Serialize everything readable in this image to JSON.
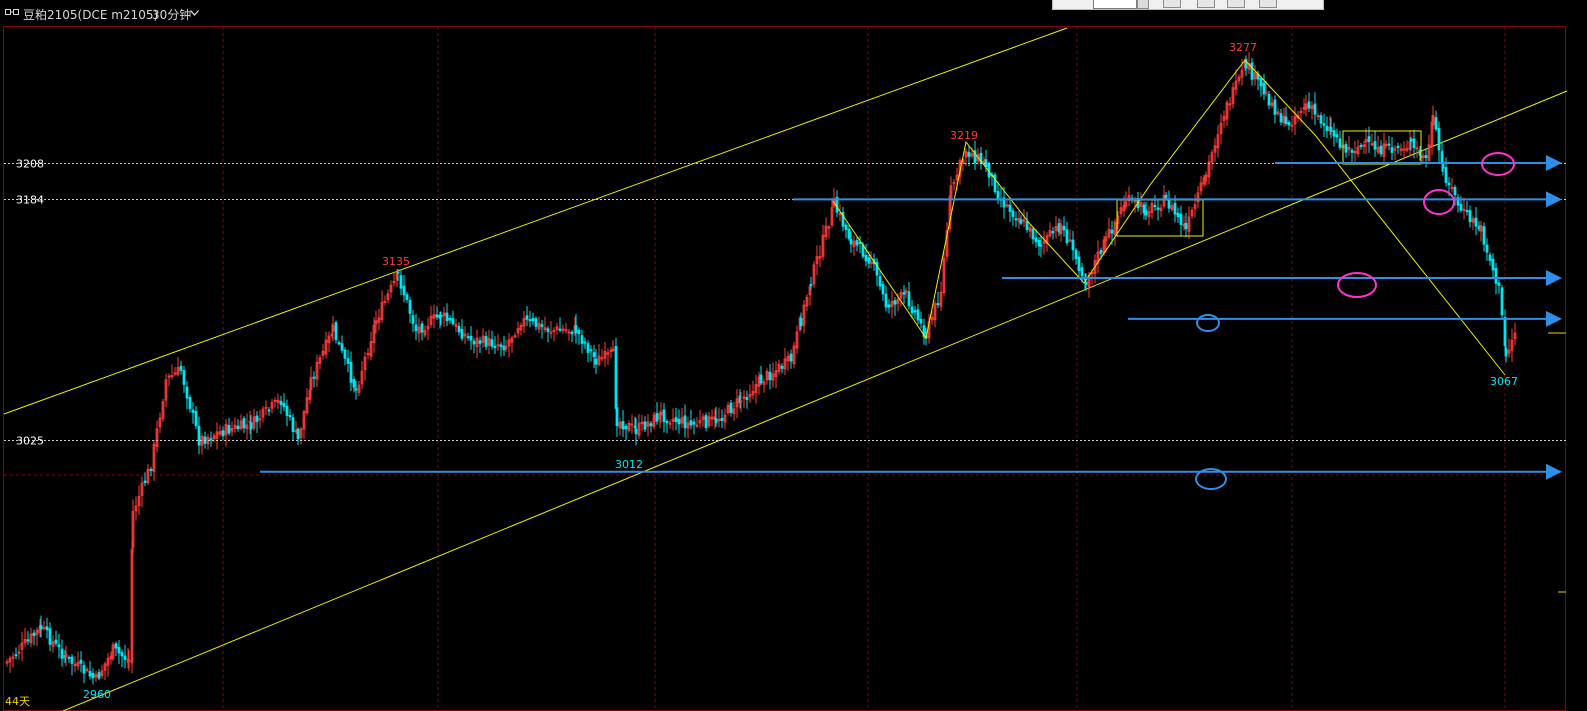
{
  "header": {
    "title": "豆粕2105(DCE m2105)",
    "period": "30分钟"
  },
  "colors": {
    "background": "#000000",
    "up_candle": "#ff3b3b",
    "down_candle": "#00e6f0",
    "grid": "#8a0000",
    "channel": "#f0f000",
    "level_line": "#2f8fe8",
    "circle_magenta": "#ff33cc",
    "circle_blue": "#2f8fe8",
    "peak_label": "#ff3b3b",
    "trough_label": "#00e6f0",
    "axis_text": "#ffffff",
    "bottom_label": "#f0d000"
  },
  "chart_data": {
    "type": "candlestick",
    "title": "豆粕2105(DCE m2105)",
    "period": "30分钟",
    "y_marks": [
      {
        "label": "3208",
        "value": 3208
      },
      {
        "label": "3184",
        "value": 3184
      },
      {
        "label": "3025",
        "value": 3025
      }
    ],
    "pivots": [
      {
        "label": "2960",
        "value": 2960,
        "kind": "low"
      },
      {
        "label": "3135",
        "value": 3135,
        "kind": "high"
      },
      {
        "label": "3012",
        "value": 3012,
        "kind": "low"
      },
      {
        "label": "3219",
        "value": 3219,
        "kind": "high"
      },
      {
        "label": "3277",
        "value": 3277,
        "kind": "high"
      },
      {
        "label": "3067",
        "value": 3067,
        "kind": "low"
      }
    ],
    "horizontal_levels": [
      3208,
      3184,
      3132,
      3105,
      3004
    ],
    "bottom_label": "44天"
  }
}
